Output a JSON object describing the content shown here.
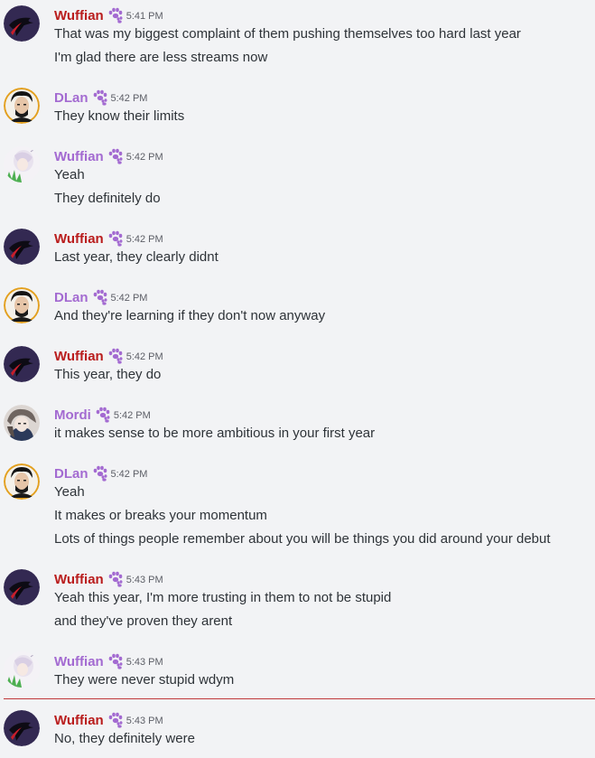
{
  "colors": {
    "wuffian_red": "#b91c1c",
    "purple": "#a36ad1",
    "timestamp": "#5c5e66",
    "new_messages_divider": "#c0393b"
  },
  "messages": [
    {
      "user": "Wuffian",
      "time": "5:41 PM",
      "avatar": "dark-avatar",
      "lines": [
        "That was my biggest complaint of them pushing themselves too hard last year",
        "I'm glad there are less streams now"
      ]
    },
    {
      "user": "DLan",
      "time": "5:42 PM",
      "avatar": "dlan-avatar",
      "lines": [
        "They know their limits"
      ]
    },
    {
      "user": "Wuffian",
      "time": "5:42 PM",
      "avatar": "anime-avatar",
      "lines": [
        "Yeah",
        "They definitely do"
      ]
    },
    {
      "user": "Wuffian",
      "time": "5:42 PM",
      "avatar": "dark-avatar",
      "lines": [
        "Last year, they clearly didnt"
      ]
    },
    {
      "user": "DLan",
      "time": "5:42 PM",
      "avatar": "dlan-avatar",
      "lines": [
        "And they're learning if they don't now anyway"
      ]
    },
    {
      "user": "Wuffian",
      "time": "5:42 PM",
      "avatar": "dark-avatar",
      "lines": [
        "This year, they do"
      ]
    },
    {
      "user": "Mordi",
      "time": "5:42 PM",
      "avatar": "mordi-avatar",
      "lines": [
        "it makes sense to be more ambitious in your first year"
      ]
    },
    {
      "user": "DLan",
      "time": "5:42 PM",
      "avatar": "dlan-avatar",
      "lines": [
        "Yeah",
        "It makes or breaks your momentum",
        "Lots of things people remember about you will be things you did around your debut"
      ]
    },
    {
      "user": "Wuffian",
      "time": "5:43 PM",
      "avatar": "dark-avatar",
      "lines": [
        "Yeah this year, I'm more trusting in them to not be stupid",
        "and they've proven they arent"
      ]
    },
    {
      "user": "Wuffian",
      "time": "5:43 PM",
      "avatar": "anime-avatar",
      "lines": [
        "They were never stupid wdym"
      ]
    },
    {
      "user": "Wuffian",
      "time": "5:43 PM",
      "avatar": "dark-avatar",
      "lines": [
        "No, they definitely were"
      ]
    }
  ]
}
